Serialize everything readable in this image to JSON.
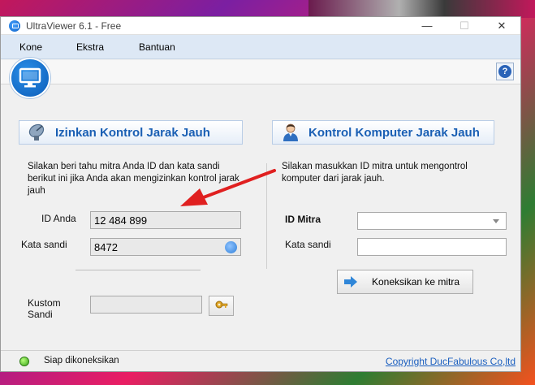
{
  "window": {
    "title": "UltraViewer 6.1 - Free",
    "minimize": "—",
    "maximize": "☐",
    "close": "✕"
  },
  "menu": {
    "items": [
      "Kone",
      "Ekstra",
      "Bantuan"
    ]
  },
  "toolbar": {
    "help": "?"
  },
  "left_panel": {
    "title": "Izinkan Kontrol Jarak Jauh",
    "description": "Silakan beri tahu mitra Anda ID dan kata sandi berikut ini jika Anda akan mengizinkan kontrol jarak jauh",
    "id_label": "ID Anda",
    "id_value": "12 484 899",
    "password_label": "Kata sandi",
    "password_value": "8472",
    "custom_password_label_line1": "Kustom",
    "custom_password_label_line2": "Sandi",
    "custom_password_value": ""
  },
  "right_panel": {
    "title": "Kontrol Komputer Jarak Jauh",
    "description": "Silakan masukkan ID mitra untuk mengontrol komputer dari jarak jauh.",
    "partner_id_label": "ID Mitra",
    "partner_id_value": "",
    "password_label": "Kata sandi",
    "password_value": "",
    "connect_button": "Koneksikan ke mitra"
  },
  "status": {
    "text": "Siap dikoneksikan",
    "copyright": "Copyright DucFabulous Co,ltd",
    "indicator_color": "#3aa31a"
  },
  "colors": {
    "accent": "#1a5fb4",
    "annotation_arrow": "#e02020"
  }
}
